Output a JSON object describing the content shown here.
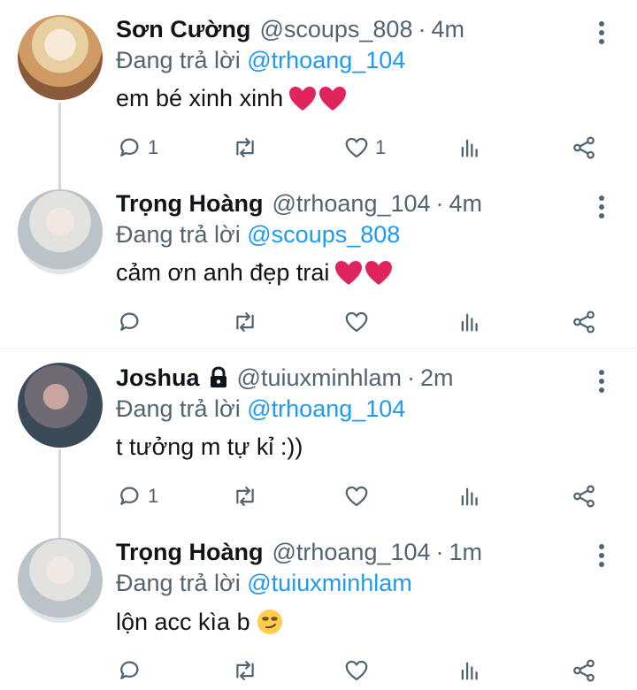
{
  "tweets": [
    {
      "name": "Sơn Cường",
      "handle": "@scoups_808",
      "separator": "·",
      "time": "4m",
      "replying_prefix": "Đang trả lời ",
      "replying_to": "@trhoang_104",
      "text": "em bé xinh xinh",
      "emoji": "two red hearts",
      "reply_count": "1",
      "retweet_count": "",
      "like_count": "1"
    },
    {
      "name": "Trọng Hoàng",
      "handle": "@trhoang_104",
      "separator": "·",
      "time": "4m",
      "replying_prefix": "Đang trả lời ",
      "replying_to": "@scoups_808",
      "text": "cảm ơn anh đẹp trai",
      "emoji": "two red hearts",
      "reply_count": "",
      "retweet_count": "",
      "like_count": ""
    },
    {
      "name": "Joshua",
      "locked": true,
      "handle": "@tuiuxminhlam",
      "separator": "·",
      "time": "2m",
      "replying_prefix": "Đang trả lời ",
      "replying_to": "@trhoang_104",
      "text": "t tưởng m tự kỉ :))",
      "reply_count": "1",
      "retweet_count": "",
      "like_count": ""
    },
    {
      "name": "Trọng Hoàng",
      "handle": "@trhoang_104",
      "separator": "·",
      "time": "1m",
      "replying_prefix": "Đang trả lời ",
      "replying_to": "@tuiuxminhlam",
      "text": "lộn acc kìa b",
      "emoji": "smirking face",
      "reply_count": "",
      "retweet_count": "",
      "like_count": ""
    }
  ],
  "icons": {
    "reply": "reply-icon",
    "retweet": "retweet-icon",
    "like": "heart-icon",
    "views": "analytics-icon",
    "share": "share-icon",
    "more": "more-vertical-icon",
    "lock": "lock-icon"
  },
  "colors": {
    "text": "#0f1419",
    "secondary": "#536471",
    "mention": "#1d9bf0",
    "thread_line": "#cfd9de",
    "heart_emoji": "#e0245e"
  }
}
